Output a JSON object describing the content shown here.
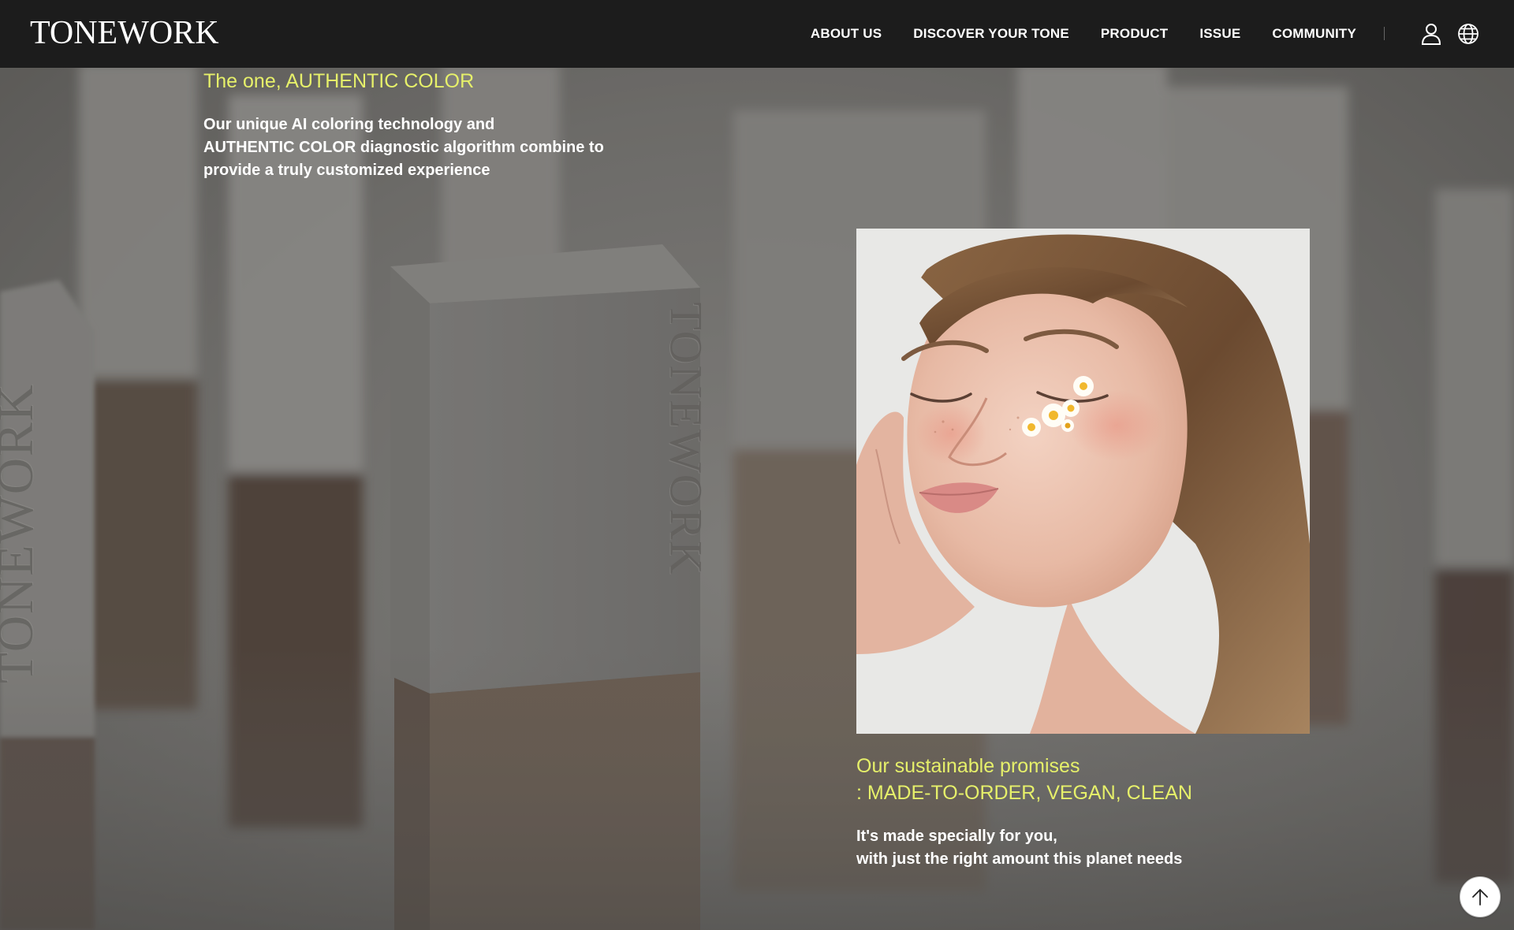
{
  "header": {
    "logo": "TONEWORK",
    "nav": [
      {
        "label": "ABOUT US"
      },
      {
        "label": "DISCOVER YOUR TONE"
      },
      {
        "label": "PRODUCT"
      },
      {
        "label": "ISSUE"
      },
      {
        "label": "COMMUNITY"
      }
    ],
    "icons": {
      "account": "user-icon",
      "language": "globe-icon"
    }
  },
  "sections": {
    "authentic": {
      "title": "The one, AUTHENTIC COLOR",
      "body_lines": [
        "Our unique AI coloring technology and",
        "AUTHENTIC COLOR diagnostic algorithm combine to",
        "provide a truly customized experience"
      ]
    },
    "sustainable": {
      "title_lines": [
        "Our sustainable promises",
        ": MADE-TO-ORDER, VEGAN, CLEAN"
      ],
      "body_lines": [
        "It's made specially for you,",
        "with just the right amount this planet needs"
      ]
    }
  },
  "background_watermark": "TONEWORK",
  "scroll_top_icon": "arrow-up-icon",
  "colors": {
    "header_bg": "#1c1c1c",
    "accent": "#e6f06a",
    "body_text": "#ffffff"
  }
}
